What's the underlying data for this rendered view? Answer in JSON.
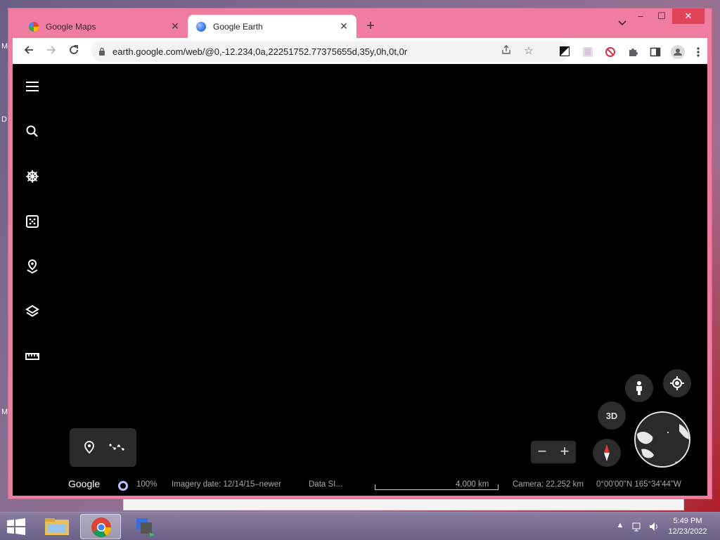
{
  "desktop": {
    "side_letters": [
      "M",
      "D",
      "M"
    ],
    "bg_window_text": "",
    "bg_window_right_text": ""
  },
  "browser": {
    "tabs": [
      {
        "title": "Google Maps",
        "active": false
      },
      {
        "title": "Google Earth",
        "active": true
      }
    ],
    "new_tab_symbol": "+",
    "tab_search_symbol": "⌄",
    "window_controls": {
      "minimize": "–",
      "maximize": "☐",
      "close": "✕"
    },
    "url": "earth.google.com/web/@0,-12.234,0a,22251752.77375655d,35y,0h,0t,0r",
    "icons": [
      "back-icon",
      "forward-icon",
      "reload-icon",
      "lock-icon",
      "share-icon",
      "star-icon",
      "extension-icons",
      "puzzle-icon",
      "sidepanel-icon",
      "profile-icon",
      "more-icon"
    ]
  },
  "earth": {
    "sidebar_icons": [
      "menu-icon",
      "search-icon",
      "voyager-icon",
      "feeling-lucky-icon",
      "projects-icon",
      "map-style-icon",
      "measure-icon"
    ],
    "buttons": {
      "three_d": "3D"
    },
    "zoom": {
      "minus": "−",
      "plus": "+"
    },
    "status": {
      "brand": "Google",
      "load_percent": "100%",
      "imagery_date": "Imagery date: 12/14/15–newer",
      "data_source": "Data SI...",
      "scale": "4,000 km",
      "camera": "Camera: 22,252 km",
      "coords": "0°00'00\"N 165°34'44\"W"
    }
  },
  "taskbar": {
    "apps": [
      "file-explorer",
      "chrome",
      "remote-app"
    ],
    "time": "5:49 PM",
    "date": "12/23/2022"
  },
  "colors": {
    "window_frame": "#f07ca0",
    "earth_bg": "#000000",
    "tab_active": "#ffffff"
  }
}
